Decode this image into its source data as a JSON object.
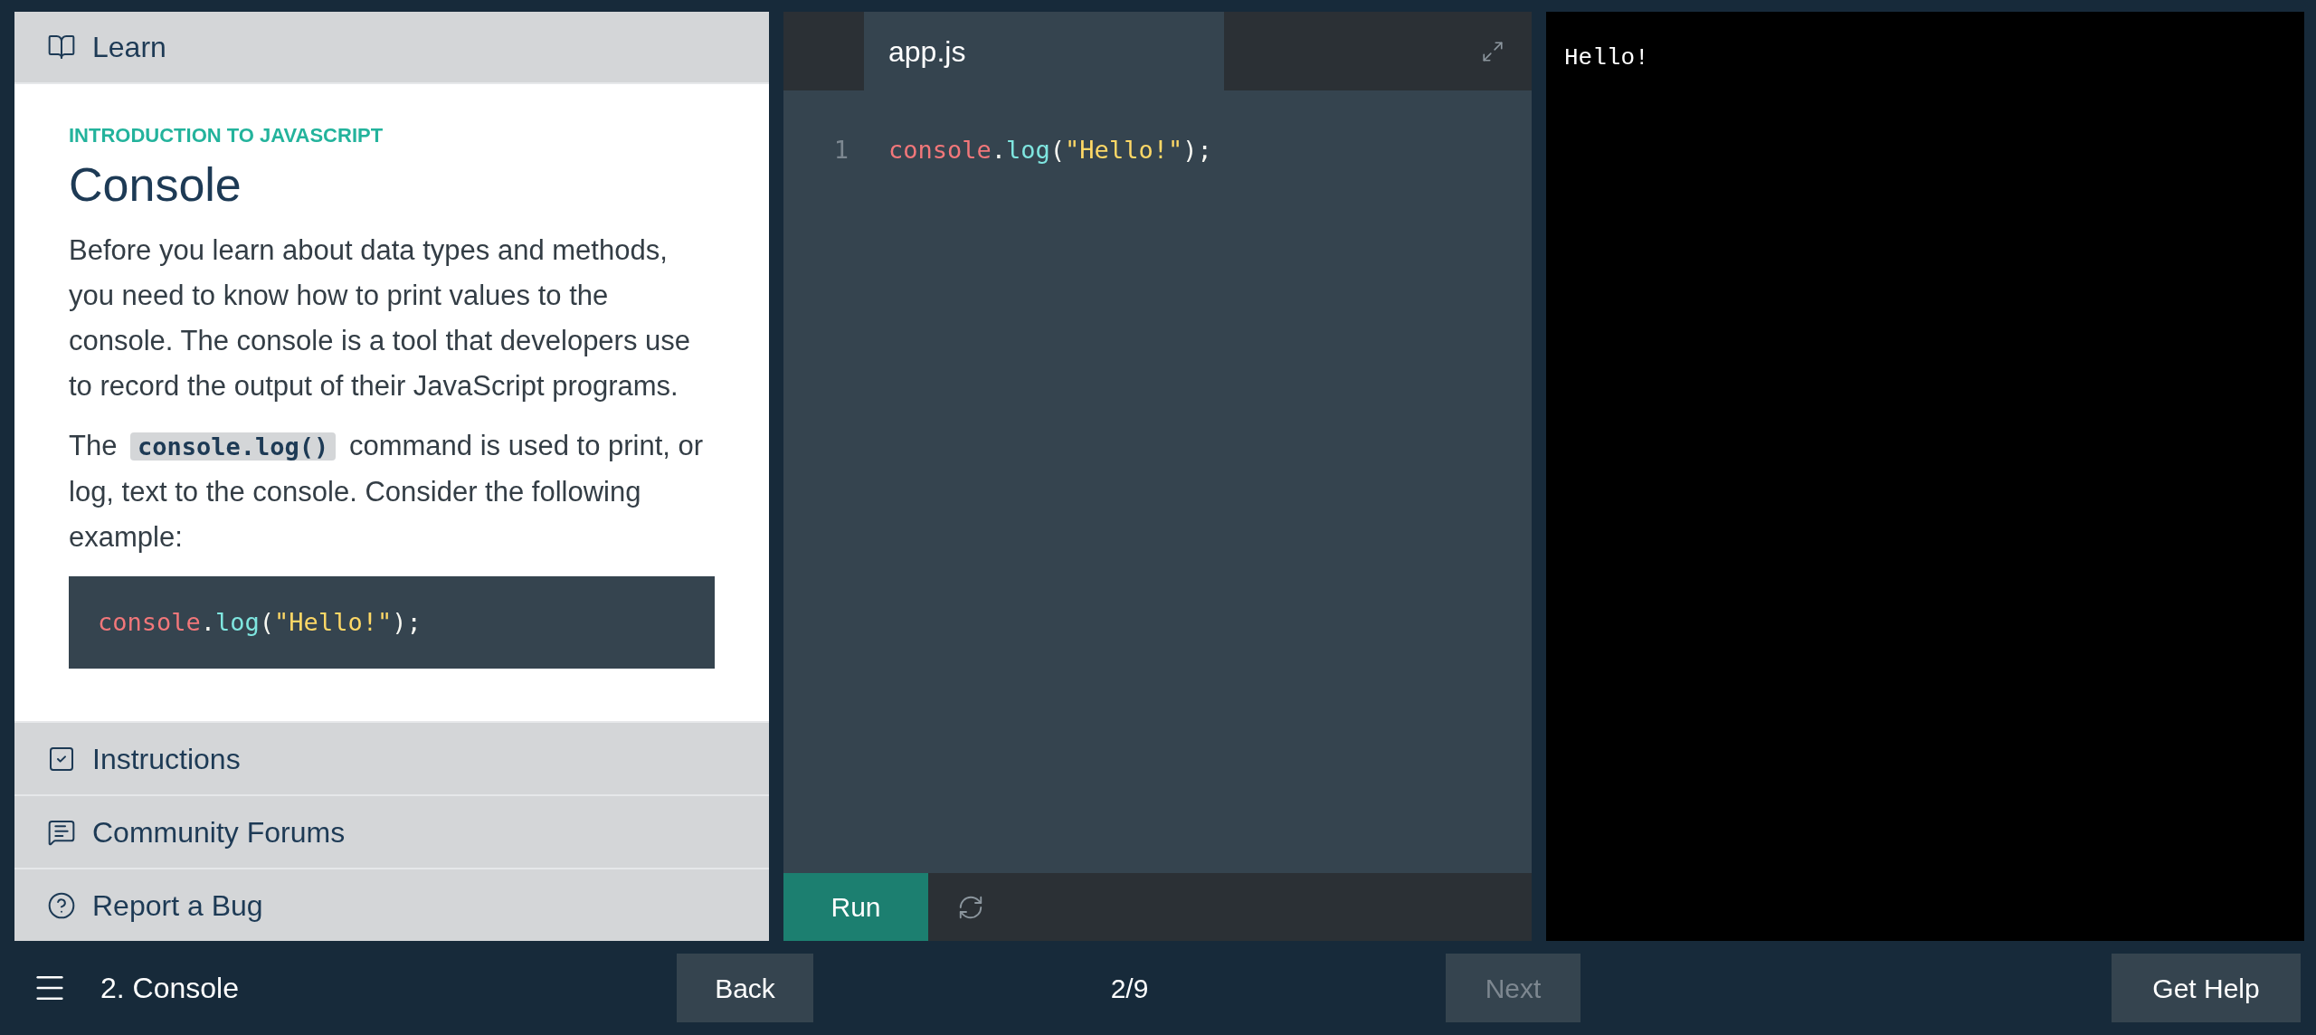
{
  "sidebar": {
    "header": {
      "label": "Learn"
    },
    "lesson": {
      "course": "INTRODUCTION TO JAVASCRIPT",
      "title": "Console",
      "paragraphs": [
        [
          {
            "kind": "text",
            "text": "Before you learn about data types and methods, you need to know how to print values to the console. The console is a tool that developers use to record the output of their JavaScript programs."
          }
        ],
        [
          {
            "kind": "text",
            "text": "The "
          },
          {
            "kind": "code",
            "text": "console.log()"
          },
          {
            "kind": "text",
            "text": " command is used to print, or log, text to the console. Consider the following example:"
          }
        ]
      ],
      "example_code": [
        {
          "kind": "object",
          "text": "console"
        },
        {
          "kind": "punct",
          "text": "."
        },
        {
          "kind": "method",
          "text": "log"
        },
        {
          "kind": "punct",
          "text": "("
        },
        {
          "kind": "string",
          "text": "\"Hello!\""
        },
        {
          "kind": "punct",
          "text": ");"
        }
      ]
    },
    "items": [
      {
        "label": "Instructions"
      },
      {
        "label": "Community Forums"
      },
      {
        "label": "Report a Bug"
      }
    ]
  },
  "editor": {
    "tabs": [
      {
        "label": "app.js",
        "selected": true
      }
    ],
    "lines": [
      {
        "number": "1",
        "tokens": [
          {
            "kind": "object",
            "text": "console"
          },
          {
            "kind": "punct",
            "text": "."
          },
          {
            "kind": "method",
            "text": "log"
          },
          {
            "kind": "punct",
            "text": "("
          },
          {
            "kind": "string",
            "text": "\"Hello!\""
          },
          {
            "kind": "punct",
            "text": ");"
          }
        ]
      }
    ],
    "run_button": "Run"
  },
  "output": {
    "lines": [
      "Hello!"
    ]
  },
  "footer": {
    "lesson": "2. Console",
    "progress": "2/9",
    "back": {
      "label": "Back",
      "disabled": false
    },
    "next": {
      "label": "Next",
      "disabled": true
    },
    "help": {
      "label": "Get Help",
      "disabled": false
    }
  }
}
